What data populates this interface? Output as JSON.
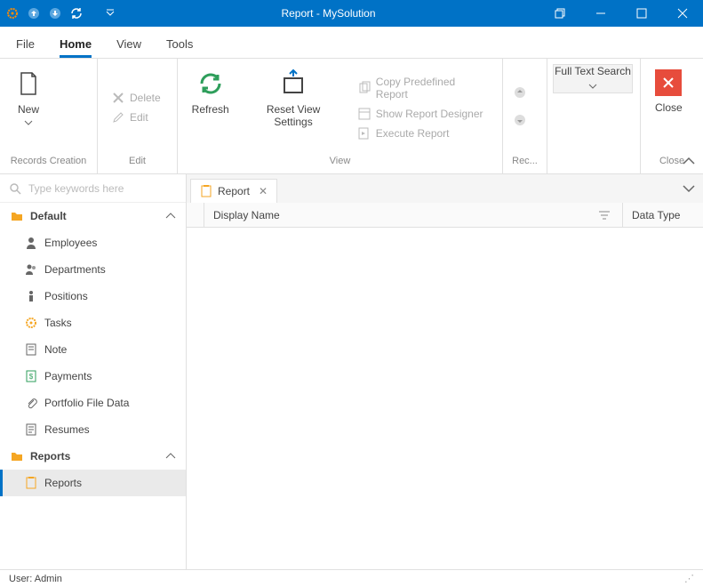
{
  "title": "Report - MySolution",
  "menu": {
    "file": "File",
    "home": "Home",
    "view": "View",
    "tools": "Tools"
  },
  "ribbon": {
    "records": {
      "new": "New",
      "label": "Records Creation"
    },
    "edit": {
      "delete": "Delete",
      "edit": "Edit",
      "label": "Edit"
    },
    "view": {
      "refresh": "Refresh",
      "reset": "Reset View Settings",
      "copy": "Copy Predefined Report",
      "designer": "Show Report Designer",
      "execute": "Execute Report",
      "label": "View"
    },
    "rec": {
      "label": "Rec..."
    },
    "fts": "Full Text Search",
    "ftslabel": "",
    "close": "Close",
    "closelabel": "Close"
  },
  "search": {
    "placeholder": "Type keywords here"
  },
  "nav": {
    "default": {
      "label": "Default",
      "items": [
        "Employees",
        "Departments",
        "Positions",
        "Tasks",
        "Note",
        "Payments",
        "Portfolio File Data",
        "Resumes"
      ]
    },
    "reports": {
      "label": "Reports",
      "items": [
        "Reports"
      ]
    }
  },
  "tab": {
    "title": "Report"
  },
  "columns": {
    "dn": "Display Name",
    "dt": "Data Type"
  },
  "status": "User: Admin"
}
